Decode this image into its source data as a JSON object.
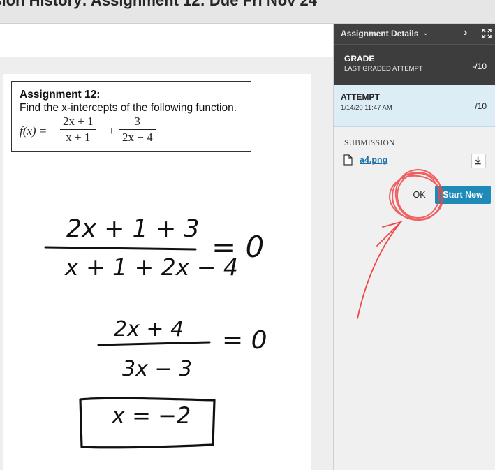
{
  "page": {
    "title": "ssion History: Assignment 12: Due Fri Nov 24"
  },
  "question": {
    "title": "Assignment 12:",
    "text": "Find the x-intercepts of the following function.",
    "formula": {
      "lhs": "f(x) =",
      "frac1_num": "2x + 1",
      "frac1_den": "x + 1",
      "plus": "+",
      "frac2_num": "3",
      "frac2_den": "2x − 4"
    }
  },
  "handwritten_work": {
    "step1_numerator": "2x + 1 + 3",
    "step1_denominator": "x + 1 + 2x − 4",
    "step1_rhs": "= 0",
    "step2_numerator": "2x + 4",
    "step2_denominator": "3x − 3",
    "step2_rhs": "= 0",
    "answer": "x = −2"
  },
  "panel": {
    "header_title": "Assignment Details",
    "chevron_icon": "chevron-down-icon",
    "next_icon": "chevron-right-icon",
    "expand_icon": "expand-icon",
    "grade_label": "GRADE",
    "grade_sub": "LAST GRADED ATTEMPT",
    "grade_value": "-/10",
    "attempt_label": "ATTEMPT",
    "attempt_date": "1/14/20 11:47 AM",
    "attempt_value": "/10",
    "submission_label": "SUBMISSION",
    "file_name": "a4.png",
    "download_icon": "download-icon"
  },
  "actions": {
    "ok_label": "OK",
    "start_new_label": "Start New"
  },
  "colors": {
    "dark_panel": "#404040",
    "attempt_bg": "#dcedf5",
    "accent_button": "#1d8ab8",
    "link": "#1b6fa8",
    "annotation_red": "#f04848"
  }
}
